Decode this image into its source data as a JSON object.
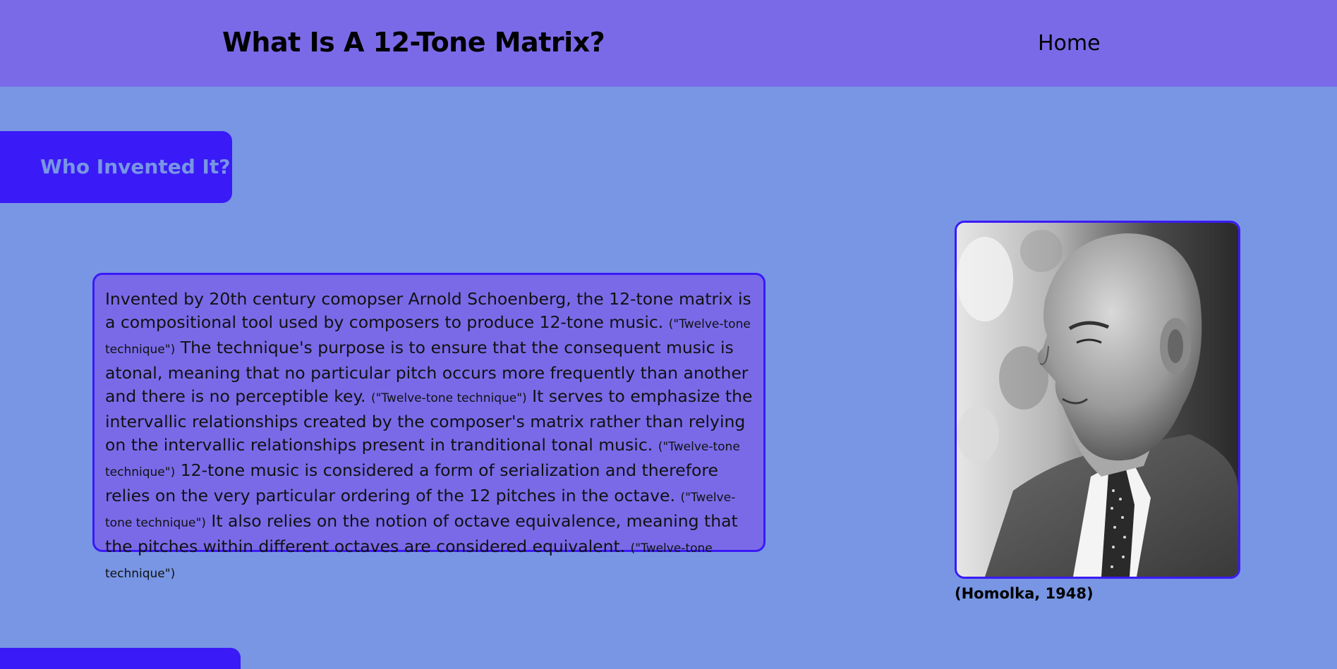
{
  "header": {
    "title": "What Is A 12-Tone Matrix?",
    "nav_home": "Home"
  },
  "section": {
    "heading": "Who Invented It?"
  },
  "article": {
    "s1": "Invented by 20th century comopser Arnold Schoenberg, the 12-tone matrix is a compositional tool used by composers to produce 12-tone music.",
    "c1": "(\"Twelve-tone technique\")",
    "s2": "The technique's purpose is to ensure that the consequent music is atonal, meaning that no particular pitch occurs more frequently than another and there is no perceptible key.",
    "c2": "(\"Twelve-tone technique\")",
    "s3": "It serves to emphasize the intervallic relationships created by the composer's matrix rather than relying on the intervallic relationships present in tranditional tonal music.",
    "c3": "(\"Twelve-tone technique\")",
    "s4": "12-tone music is considered a form of serialization and therefore relies on the very particular ordering of the 12 pitches in the octave.",
    "c4": "(\"Twelve-tone technique\")",
    "s5": "It also relies on the notion of octave equivalence, meaning that the pitches within different octaves are considered equivalent.",
    "c5": "(\"Twelve-tone technique\")"
  },
  "figure": {
    "caption": "(Homolka, 1948)"
  },
  "colors": {
    "page_background": "#7896e4",
    "header_background": "#7b6ae8",
    "accent": "#3a1af7"
  }
}
